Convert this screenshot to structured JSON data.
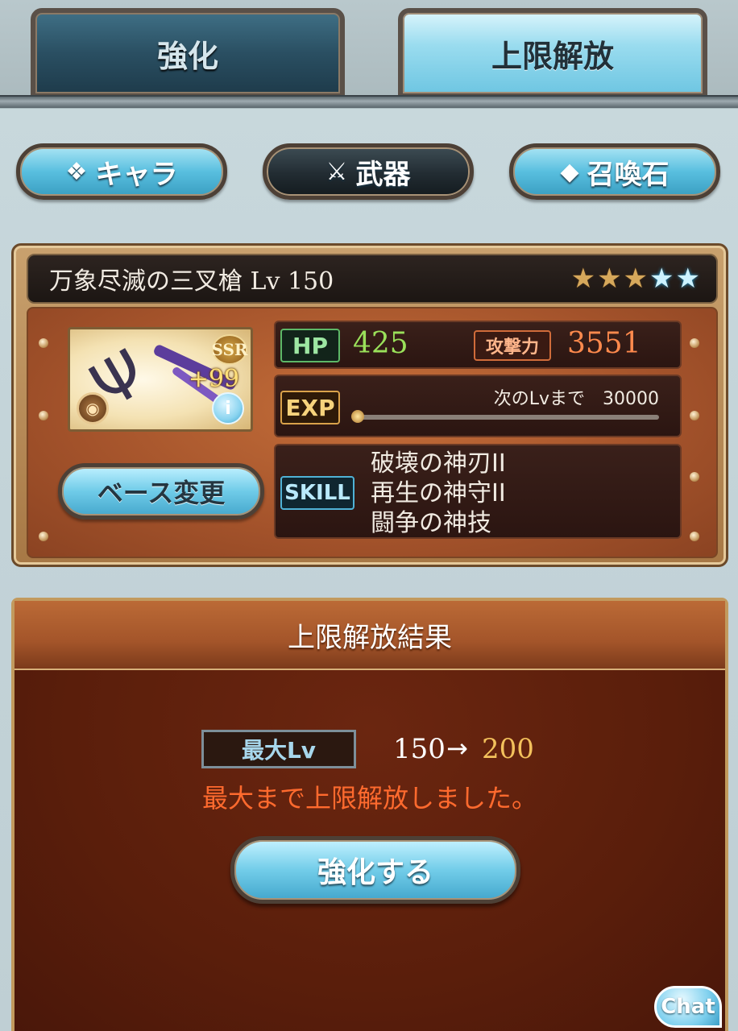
{
  "tabs": [
    {
      "label": "強化",
      "active": false
    },
    {
      "label": "上限解放",
      "active": true
    }
  ],
  "categories": [
    {
      "label": "キャラ",
      "icon": "wings-icon",
      "selected": false
    },
    {
      "label": "武器",
      "icon": "crossed-swords-icon",
      "selected": true
    },
    {
      "label": "召喚石",
      "icon": "crystal-icon",
      "selected": false
    }
  ],
  "weapon": {
    "name": "万象尽滅の三叉槍 Lv 150",
    "rarity": "SSR",
    "plus": "+99",
    "stars_total": 5,
    "stars_gold": 3,
    "stars_blue": 2,
    "hp_label": "HP",
    "hp": "425",
    "atk_label": "攻撃力",
    "atk": "3551",
    "exp_label": "EXP",
    "next_lv_text": "次のLvまで　30000",
    "exp_progress": 0,
    "skill_label": "SKILL",
    "skills": [
      "破壊の神刃II",
      "再生の神守II",
      "闘争の神技"
    ]
  },
  "base_change_label": "ベース変更",
  "result": {
    "title": "上限解放結果",
    "max_lv_label": "最大Lv",
    "lv_from": "150",
    "arrow": "→",
    "lv_to": "200",
    "message": "最大まで上限解放しました。",
    "enhance_label": "強化する"
  },
  "chat_label": "Chat",
  "colors": {
    "hp": "#9ae15a",
    "atk": "#ff8a4d",
    "message": "#ff6a2e",
    "lv_to": "#f3c15c"
  }
}
